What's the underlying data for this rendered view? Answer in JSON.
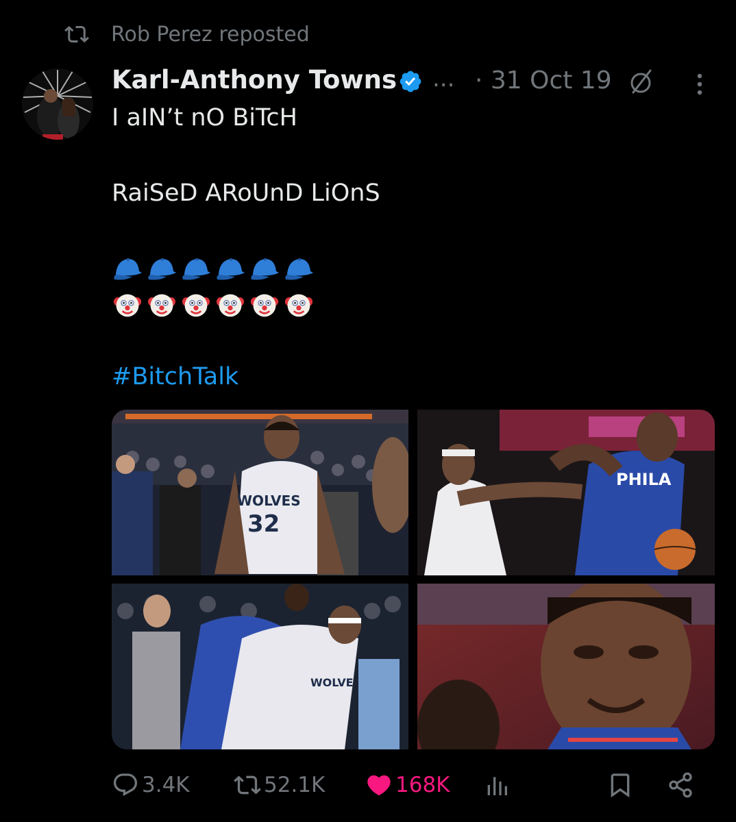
{
  "repost": {
    "icon": "repost-icon",
    "text": "Rob Perez reposted"
  },
  "author": {
    "name": "Karl-Anthony Towns",
    "verified": true,
    "ellipsis": "...",
    "time": "· 31 Oct 19"
  },
  "tweet": {
    "line1": "I aIN’t nO BiTcH",
    "line2": "RaiSeD ARoUnD LiOnS",
    "emoji_row1": "cap-emoji",
    "emoji_row2": "clown-emoji",
    "hashtag": "#BitchTalk"
  },
  "media": {
    "photos": [
      {
        "name": "photo-towns-wolves-32",
        "jersey_text": "WOLVES",
        "jersey_number": "32"
      },
      {
        "name": "photo-embiid-phila",
        "jersey_text": "PHILA"
      },
      {
        "name": "photo-scuffle-referee"
      },
      {
        "name": "photo-embiid-closeup"
      }
    ]
  },
  "actions": {
    "replies": "3.4K",
    "reposts": "52.1K",
    "likes": "168K",
    "views_icon": "views-icon",
    "bookmark_icon": "bookmark-icon",
    "share_icon": "share-icon"
  },
  "colors": {
    "background": "#000000",
    "text": "#e7e9ea",
    "muted": "#71767b",
    "link": "#1d9bf0",
    "like": "#f91880",
    "verified": "#1d9bf0"
  }
}
